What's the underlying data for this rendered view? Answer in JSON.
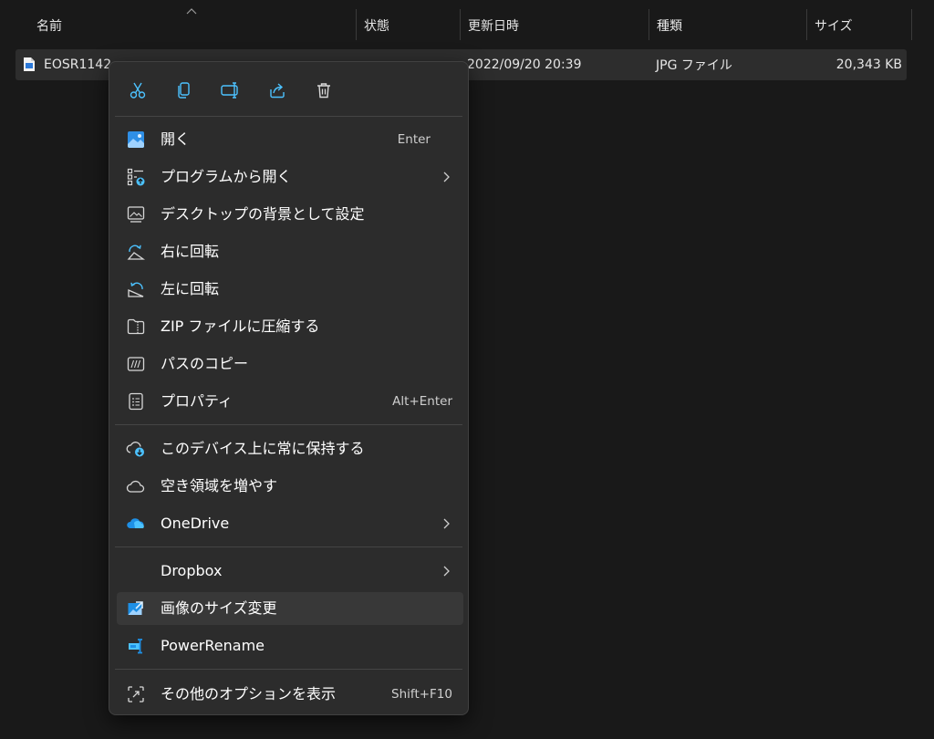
{
  "columns": {
    "name": "名前",
    "status": "状態",
    "modified": "更新日時",
    "type": "種類",
    "size": "サイズ"
  },
  "file": {
    "name": "EOSR1142",
    "modified": "2022/09/20 20:39",
    "type": "JPG ファイル",
    "size": "20,343 KB"
  },
  "toolbar": {
    "icons": [
      "cut-icon",
      "copy-icon",
      "rename-icon",
      "share-icon",
      "delete-icon"
    ]
  },
  "menu": {
    "open": {
      "label": "開く",
      "shortcut": "Enter"
    },
    "open_with": {
      "label": "プログラムから開く"
    },
    "set_background": {
      "label": "デスクトップの背景として設定"
    },
    "rotate_right": {
      "label": "右に回転"
    },
    "rotate_left": {
      "label": "左に回転"
    },
    "compress_zip": {
      "label": "ZIP ファイルに圧縮する"
    },
    "copy_path": {
      "label": "パスのコピー"
    },
    "properties": {
      "label": "プロパティ",
      "shortcut": "Alt+Enter"
    },
    "keep_on_device": {
      "label": "このデバイス上に常に保持する"
    },
    "free_space": {
      "label": "空き領域を増やす"
    },
    "onedrive": {
      "label": "OneDrive"
    },
    "dropbox": {
      "label": "Dropbox"
    },
    "image_resizer": {
      "label": "画像のサイズ変更"
    },
    "power_rename": {
      "label": "PowerRename"
    },
    "more_options": {
      "label": "その他のオプションを表示",
      "shortcut": "Shift+F10"
    }
  },
  "colors": {
    "background": "#191919",
    "menu_background": "#2c2c2c",
    "accent_blue": "#4cc2ff",
    "onedrive_blue": "#1e90e6"
  }
}
